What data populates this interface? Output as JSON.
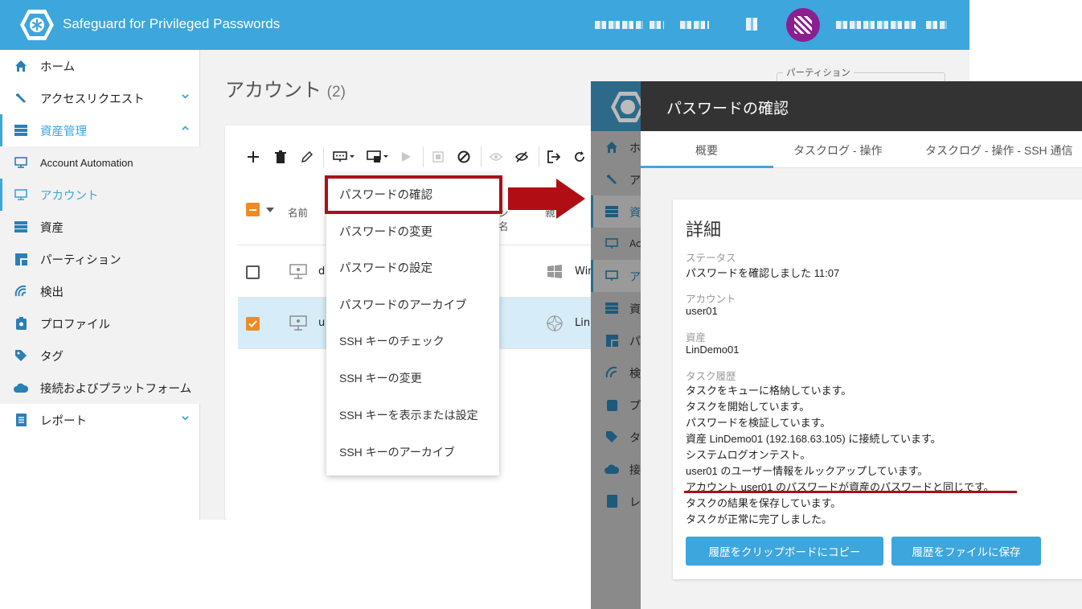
{
  "app": {
    "title": "Safeguard for Privileged Passwords"
  },
  "sidebar": {
    "items": [
      {
        "label": "ホーム",
        "icon": "home-icon"
      },
      {
        "label": "アクセスリクエスト",
        "icon": "wrench-icon"
      },
      {
        "label": "資産管理",
        "icon": "server-icon"
      },
      {
        "label": "Account Automation",
        "icon": "monitor-icon"
      },
      {
        "label": "アカウント",
        "icon": "monitor-icon"
      },
      {
        "label": "資産",
        "icon": "server-icon"
      },
      {
        "label": "パーティション",
        "icon": "partition-icon"
      },
      {
        "label": "検出",
        "icon": "discovery-icon"
      },
      {
        "label": "プロファイル",
        "icon": "profile-icon"
      },
      {
        "label": "タグ",
        "icon": "tag-icon"
      },
      {
        "label": "接続およびプラットフォーム",
        "icon": "cloud-icon"
      },
      {
        "label": "レポート",
        "icon": "report-icon"
      }
    ]
  },
  "page": {
    "title": "アカウント",
    "count": "(2)",
    "partition_label": "パーティション"
  },
  "table": {
    "col_name": "名前",
    "col_partial_1": "ン",
    "col_partial_2": "名",
    "col_parent": "親",
    "rows": [
      {
        "name": "d",
        "platform": "Win"
      },
      {
        "name": "u",
        "platform": "Lin"
      }
    ]
  },
  "menu": {
    "items": [
      "パスワードの確認",
      "パスワードの変更",
      "パスワードの設定",
      "パスワードのアーカイブ",
      "SSH キーのチェック",
      "SSH キーの変更",
      "SSH キーを表示または設定",
      "SSH キーのアーカイブ"
    ]
  },
  "overlay_sidebar": {
    "items": [
      "ホ",
      "ア",
      "資",
      "Ac",
      "ア",
      "資",
      "パ",
      "検",
      "プ",
      "タ",
      "接",
      "レ"
    ]
  },
  "dialog": {
    "title": "パスワードの確認",
    "tabs": [
      "概要",
      "タスクログ - 操作",
      "タスクログ - 操作 - SSH 通信"
    ],
    "details_title": "詳細",
    "status_label": "ステータス",
    "status_value": "パスワードを確認しました 11:07",
    "account_label": "アカウント",
    "account_value": "user01",
    "asset_label": "資産",
    "asset_value": "LinDemo01",
    "history_label": "タスク履歴",
    "history": [
      "タスクをキューに格納しています。",
      "タスクを開始しています。",
      "パスワードを検証しています。",
      "資産 LinDemo01 (192.168.63.105) に接続しています。",
      "システムログオンテスト。",
      "user01 のユーザー情報をルックアップしています。",
      "アカウント user01 のパスワードが資産のパスワードと同じです。",
      "タスクの結果を保存しています。",
      "タスクが正常に完了しました。"
    ],
    "copy_button": "履歴をクリップボードにコピー",
    "save_button": "履歴をファイルに保存"
  },
  "colors": {
    "topbar": "#3da6dd",
    "accent": "#3da6dd",
    "checkbox": "#f08a24",
    "highlight": "#a8101a",
    "dialog_header": "#333333"
  }
}
